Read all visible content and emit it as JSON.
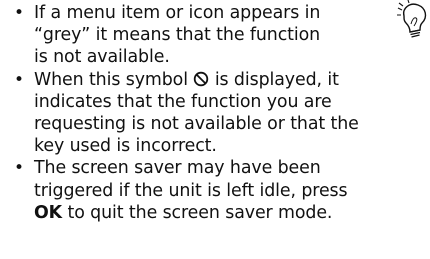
{
  "notes": {
    "items": [
      {
        "lines": [
          "If a menu item or icon appears in",
          "“grey” it means that the function",
          "is not available."
        ]
      },
      {
        "line1_before": "When this symbol",
        "line1_after": "is displayed, it",
        "lines": [
          "indicates that the function you are",
          "requesting is not available or that the",
          "key used is incorrect."
        ]
      },
      {
        "lines": [
          "The screen saver may have been",
          "triggered if the unit is left idle, press"
        ],
        "last_bold": "OK",
        "last_rest": "to quit the screen saver mode."
      }
    ],
    "icons": {
      "unavailable_symbol": "no-entry-circle-icon",
      "tip": "lightbulb-icon"
    }
  }
}
